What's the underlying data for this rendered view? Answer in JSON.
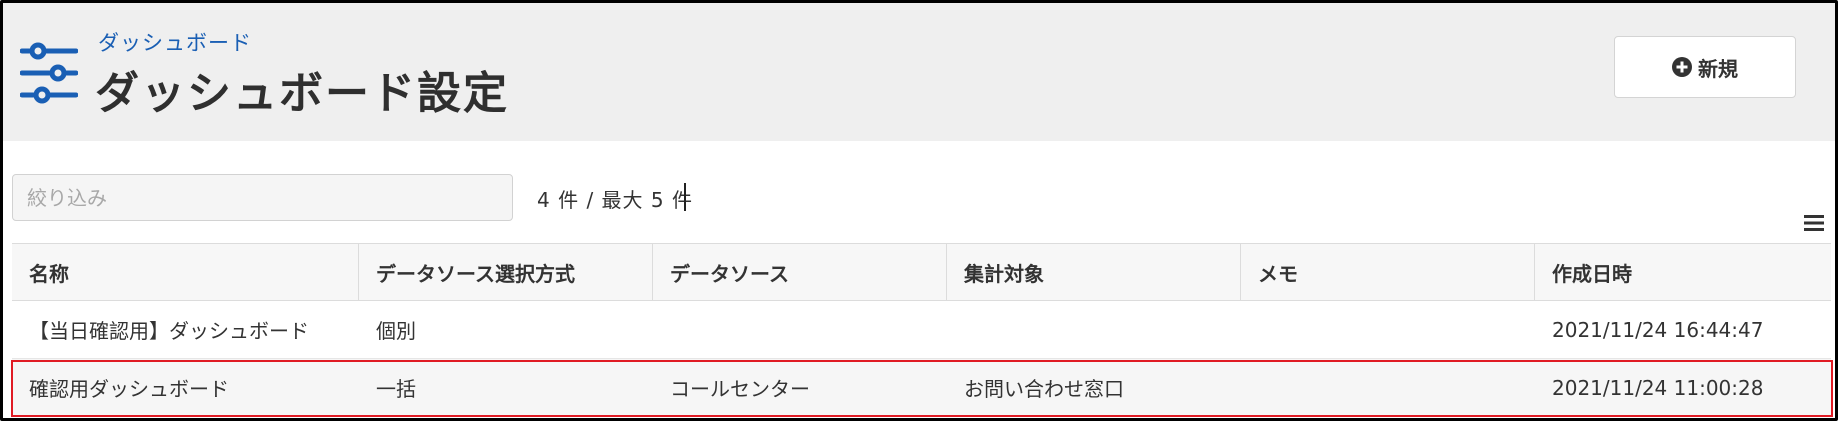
{
  "header": {
    "breadcrumb": "ダッシュボード",
    "title": "ダッシュボード設定",
    "icon": "sliders-icon",
    "new_button_label": "新規",
    "new_button_icon": "plus-circle-icon"
  },
  "toolbar": {
    "filter_placeholder": "絞り込み",
    "filter_value": "",
    "count_text": "4 件 / 最大 5 件",
    "menu_icon": "hamburger-menu-icon"
  },
  "table": {
    "columns": [
      "名称",
      "データソース選択方式",
      "データソース",
      "集計対象",
      "メモ",
      "作成日時"
    ],
    "rows": [
      [
        "【当日確認用】ダッシュボード",
        "個別",
        "",
        "",
        "",
        "2021/11/24 16:44:47"
      ],
      [
        "確認用ダッシュボード",
        "一括",
        "コールセンター",
        "お問い合わせ窓口",
        "",
        "2021/11/24 11:00:28"
      ]
    ]
  },
  "colors": {
    "accent": "#1a5fb4",
    "header_bg": "#efefef",
    "highlight": "#e01b24"
  }
}
